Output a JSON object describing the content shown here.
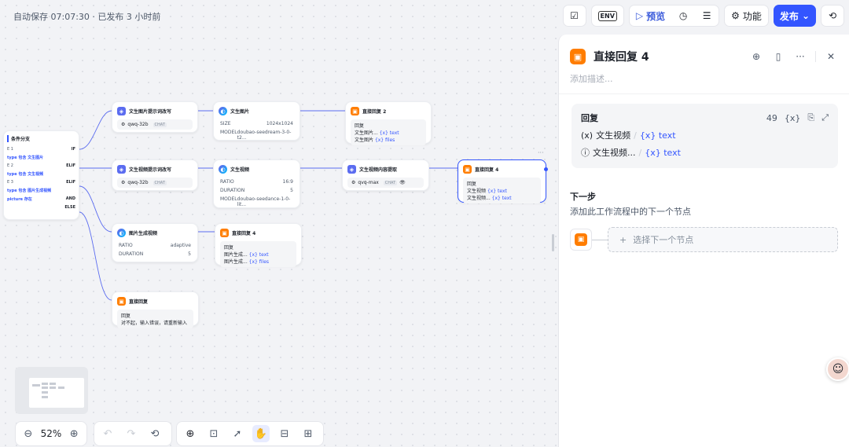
{
  "header": {
    "autosave_text": "自动保存 07:07:30 · 已发布 3 小时前",
    "env_label": "ENV",
    "preview_label": "预览",
    "features_label": "功能",
    "publish_label": "发布"
  },
  "nodes": {
    "condition": {
      "title": "条件分支",
      "rows": [
        {
          "left": "E 1",
          "right": "IF"
        },
        {
          "left": "type 包含 文生图片",
          "right": ""
        },
        {
          "left": "E 2",
          "right": "ELIF"
        },
        {
          "left": "type 包含 文生视频",
          "right": ""
        },
        {
          "left": "E 3",
          "right": "ELIF"
        },
        {
          "left": "type 包含 图片生成视频",
          "right": ""
        },
        {
          "left": "picture 存在",
          "right": "AND"
        },
        {
          "left": "",
          "right": "ELSE"
        }
      ]
    },
    "llm1": {
      "title": "文生图片提示词改写",
      "model": "qwq-32b",
      "tag": "CHAT"
    },
    "llm2": {
      "title": "文生视频提示词改写",
      "model": "qwq-32b",
      "tag": "CHAT"
    },
    "img_gen": {
      "title": "文生图片",
      "size_k": "SIZE",
      "size_v": "1024x1024",
      "model_k": "MODEL",
      "model_v": "doubao-seedream-3-0-t2..."
    },
    "vid_gen": {
      "title": "文生视频",
      "ratio_k": "RATIO",
      "ratio_v": "16:9",
      "dur_k": "DURATION",
      "dur_v": "5",
      "model_k": "MODEL",
      "model_v": "doubao-seedance-1-0-lit..."
    },
    "img2vid": {
      "title": "图片生成视频",
      "ratio_k": "RATIO",
      "ratio_v": "adaptive",
      "dur_k": "DURATION",
      "dur_v": "5"
    },
    "reply2": {
      "title": "直接回复 2",
      "sub": "回复",
      "l1": "文生图片...",
      "l1v": "{x} text",
      "l2": "文生图片",
      "l2v": "{x} files"
    },
    "extract": {
      "title": "文生视频内容提取",
      "model": "qvq-max",
      "tag": "CHAT"
    },
    "reply4": {
      "title": "直接回复 4",
      "sub": "回复",
      "l1": "文生视频",
      "l1v": "{x} text",
      "l2": "文生视频...",
      "l2v": "{x} text"
    },
    "reply4b": {
      "title": "直接回复 4",
      "sub": "回复",
      "l1": "图片生成...",
      "l1v": "{x} text",
      "l2": "图片生成...",
      "l2v": "{x} files"
    },
    "reply_plain": {
      "title": "直接回复",
      "sub": "回复",
      "body": "对不起，输入错误，请重新输入"
    }
  },
  "canvas_controls": {
    "zoom_value": "52%"
  },
  "panel": {
    "title": "直接回复 4",
    "desc_placeholder": "添加描述...",
    "reply_label": "回复",
    "reply_count": "49",
    "reply_var_btn": "{x}",
    "line1_name": "文生视频",
    "line1_var": "{x} text",
    "line2_name": "文生视频...",
    "line2_var": "{x} text",
    "next_title": "下一步",
    "next_desc": "添加此工作流程中的下一个节点",
    "select_next": "选择下一个节点"
  },
  "colors": {
    "accent": "#3355ff",
    "reply_orange": "#ff7d00"
  }
}
